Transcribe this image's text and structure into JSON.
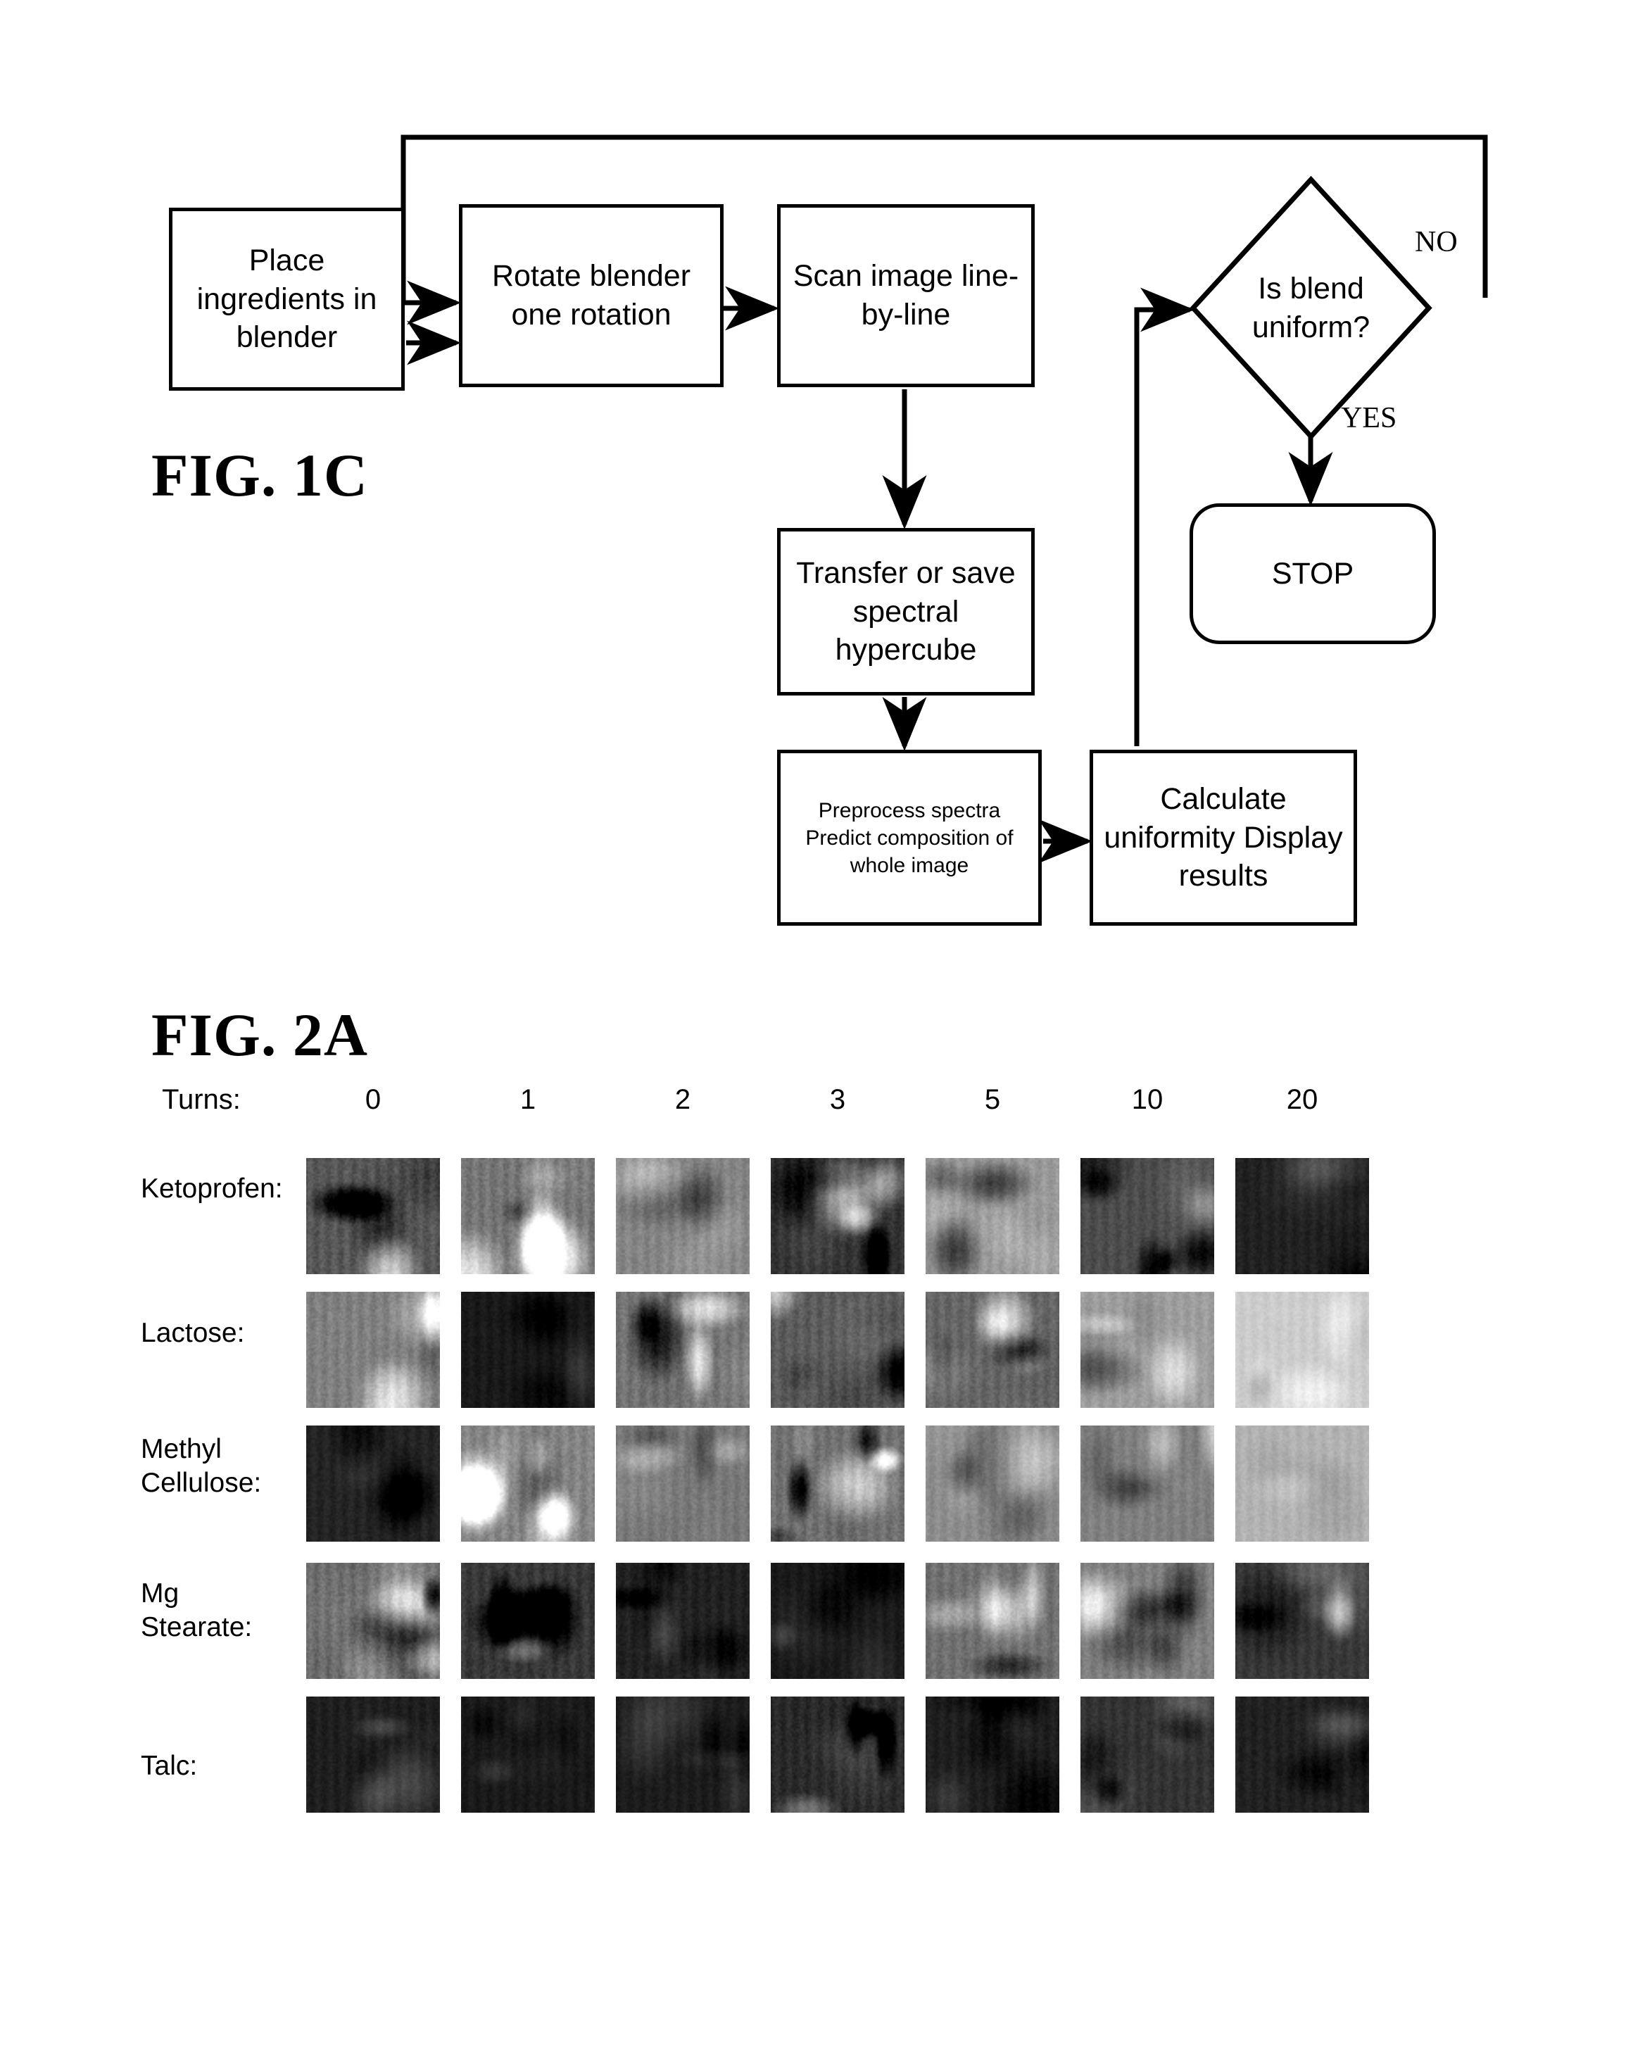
{
  "figures": {
    "fig1c": {
      "label": "FIG. 1C",
      "nodes": {
        "place": "Place\ningredients\nin blender",
        "rotate": "Rotate\nblender one\nrotation",
        "scan": "Scan image\nline-by-line",
        "transfer": "Transfer or\nsave spectral\nhypercube",
        "preprocess": "Preprocess spectra\nPredict composition\nof whole image",
        "calculate": "Calculate\nuniformity\nDisplay results",
        "decision": "Is blend\nuniform?",
        "stop": "STOP"
      },
      "edge_labels": {
        "no": "NO",
        "yes": "YES"
      }
    },
    "fig2a": {
      "label": "FIG. 2A",
      "turns_label": "Turns:",
      "columns": [
        "0",
        "1",
        "2",
        "3",
        "5",
        "10",
        "20"
      ],
      "rows": [
        {
          "label": "Ketoprofen:"
        },
        {
          "label": "Lactose:"
        },
        {
          "label": "Methyl\nCellulose:"
        },
        {
          "label": "Mg\nStearate:"
        },
        {
          "label": "Talc:"
        }
      ],
      "tile_brightness": [
        [
          0.34,
          0.46,
          0.52,
          0.2,
          0.6,
          0.3,
          0.13
        ],
        [
          0.5,
          0.1,
          0.46,
          0.36,
          0.4,
          0.62,
          0.8
        ],
        [
          0.14,
          0.52,
          0.47,
          0.44,
          0.55,
          0.5,
          0.7
        ],
        [
          0.42,
          0.22,
          0.13,
          0.1,
          0.44,
          0.5,
          0.22
        ],
        [
          0.12,
          0.1,
          0.11,
          0.16,
          0.12,
          0.2,
          0.13
        ]
      ],
      "tile_contrast": [
        [
          0.62,
          0.66,
          0.46,
          0.46,
          0.42,
          0.36,
          0.18
        ],
        [
          0.55,
          0.12,
          0.55,
          0.52,
          0.5,
          0.34,
          0.14
        ],
        [
          0.18,
          0.62,
          0.4,
          0.58,
          0.34,
          0.32,
          0.22
        ],
        [
          0.64,
          0.46,
          0.24,
          0.12,
          0.52,
          0.44,
          0.3
        ],
        [
          0.16,
          0.1,
          0.12,
          0.4,
          0.16,
          0.28,
          0.18
        ]
      ]
    }
  },
  "colors": {
    "ink": "#000000",
    "paper": "#ffffff"
  }
}
